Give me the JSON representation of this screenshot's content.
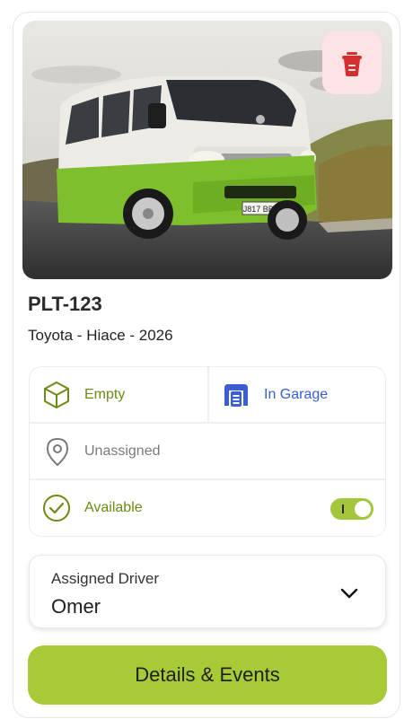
{
  "vehicle": {
    "plate": "PLT-123",
    "description": "Toyota - Hiace - 2026",
    "photo_plate_text": "J817 BBC"
  },
  "status": {
    "load": {
      "label": "Empty",
      "icon": "box-icon"
    },
    "location": {
      "label": "In Garage",
      "icon": "garage-icon"
    },
    "assignment": {
      "label": "Unassigned",
      "icon": "location-pin-icon"
    },
    "availability": {
      "label": "Available",
      "icon": "check-circle-icon",
      "toggle_on": true
    }
  },
  "driver": {
    "label": "Assigned Driver",
    "value": "Omer"
  },
  "actions": {
    "details_label": "Details & Events",
    "delete_icon": "trash-icon"
  },
  "colors": {
    "accent_green": "#a8ca36",
    "status_green": "#6a8c12",
    "status_blue": "#3b5fd0",
    "delete_bg": "#fde3e6",
    "delete_icon": "#d32f2f"
  }
}
